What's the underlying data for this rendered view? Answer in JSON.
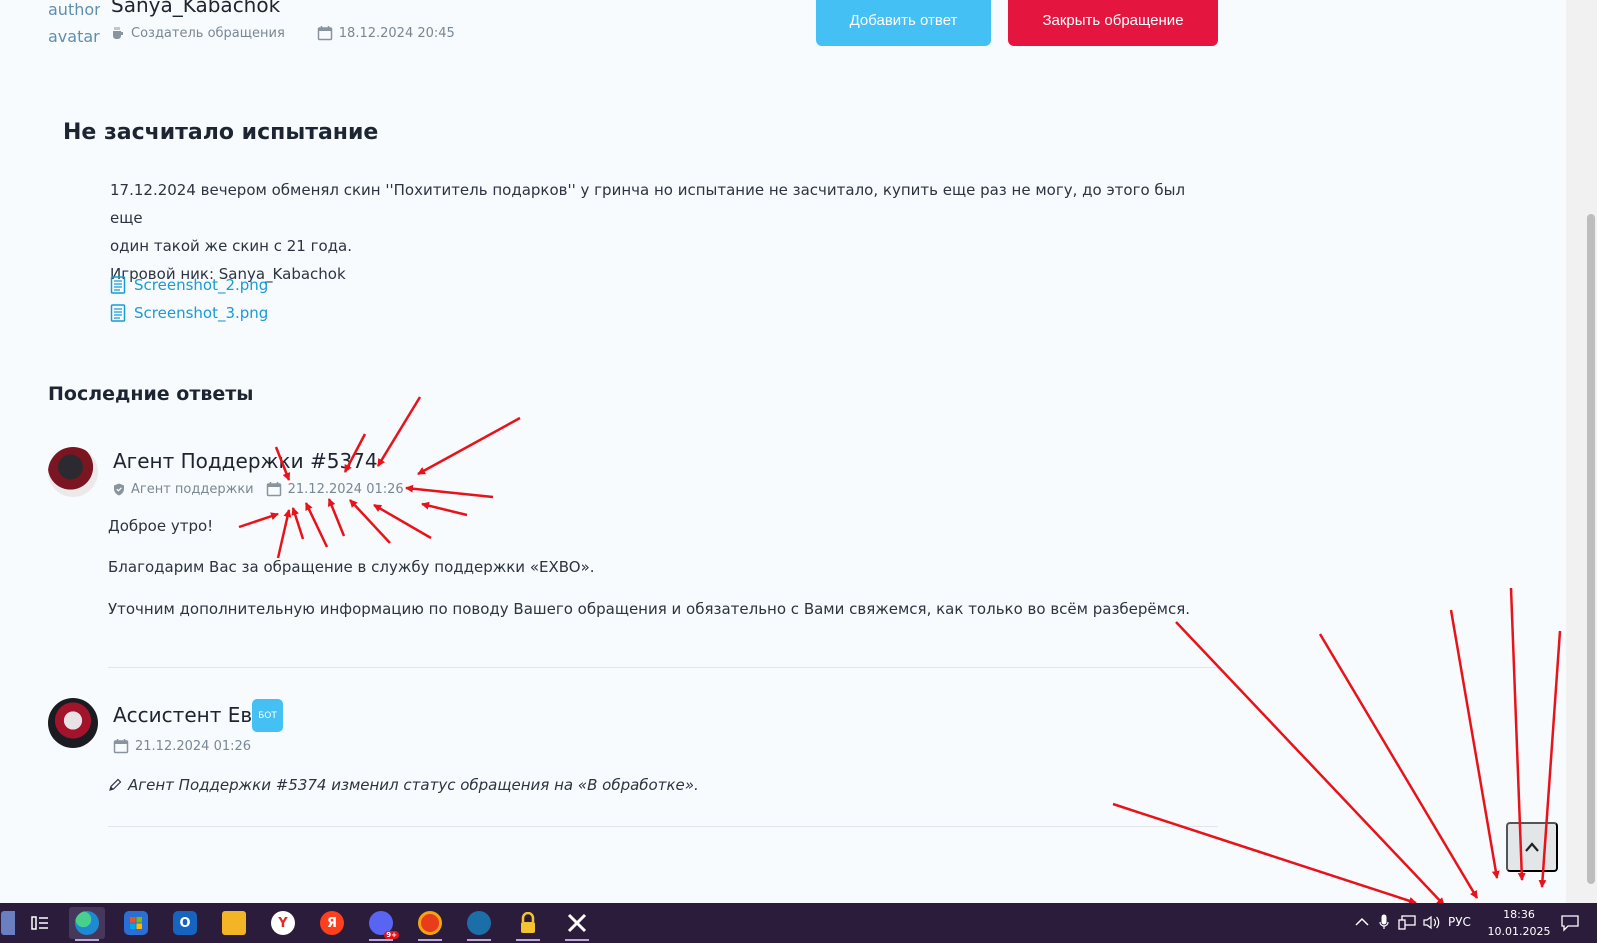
{
  "ticket": {
    "author_avatar_alt": "author avatar",
    "author_name": "Sanya_Kabachok",
    "author_role": "Создатель обращения",
    "created_at": "18.12.2024 20:45",
    "add_reply_label": "Добавить ответ",
    "close_ticket_label": "Закрыть обращение",
    "title": "Не засчитало испытание",
    "body_line1": "17.12.2024 вечером обменял скин ''Похититель подарков'' у гринча но испытание не засчитало, купить еще раз не могу, до этого был еще",
    "body_line2": "один такой же скин с 21 года.",
    "body_line3": "Игровой ник: Sanya_Kabachok",
    "attachments": [
      "Screenshot_2.png",
      "Screenshot_3.png"
    ]
  },
  "replies": {
    "heading": "Последние ответы",
    "items": [
      {
        "author": "Агент Поддержки #5374",
        "role": "Агент поддержки",
        "date": "21.12.2024 01:26",
        "lines": [
          "Доброе утро!",
          "Благодарим Вас за обращение в службу поддержки «EXBO».",
          "Уточним дополнительную информацию по поводу Вашего обращения и обязательно с Вами свяжемся, как только во всём разберёмся."
        ]
      },
      {
        "author": "Ассистент Ева",
        "badge": "БОТ",
        "date": "21.12.2024 01:26",
        "status_text": "Агент Поддержки #5374 изменил статус обращения на «В обработке»."
      }
    ]
  },
  "taskbar": {
    "language": "РУС",
    "time": "18:36",
    "date": "10.01.2025",
    "discord_badge": "9+",
    "apps": [
      "widgets-icon",
      "task-view-icon",
      "edge-icon",
      "store-icon",
      "outlook-icon",
      "explorer-icon",
      "yandex-browser-icon",
      "yandex-icon",
      "discord-icon",
      "app-orange-icon",
      "steam-icon",
      "vpn-lock-icon",
      "tools-icon"
    ]
  },
  "colors": {
    "accent_blue": "#44c0f5",
    "danger_red": "#e4153f",
    "link": "#1a9bd1",
    "annotation_arrows": "#e8131a",
    "taskbar": "#2b1c3b"
  }
}
